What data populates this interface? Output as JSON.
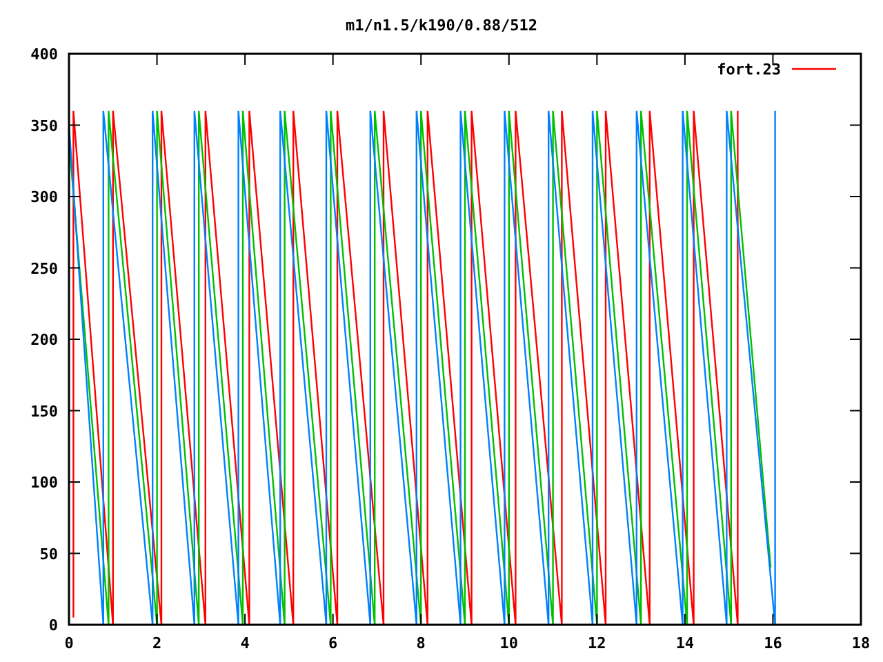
{
  "plot": {
    "chart_data": {
      "type": "line",
      "title": "m1/n1.5/k190/0.88/512",
      "xlim": [
        0,
        18
      ],
      "ylim": [
        0,
        400
      ],
      "xticks": [
        0,
        2,
        4,
        6,
        8,
        10,
        12,
        14,
        16,
        18
      ],
      "yticks": [
        0,
        50,
        100,
        150,
        200,
        250,
        300,
        350,
        400
      ],
      "series": [
        {
          "name": "fort.23",
          "color": "#ff0000",
          "x": [
            0.1,
            0.1,
            0.1,
            1.0,
            1.0,
            2.1,
            2.1,
            3.1,
            3.1,
            4.1,
            4.1,
            5.1,
            5.1,
            6.1,
            6.1,
            7.15,
            7.15,
            8.15,
            8.15,
            9.15,
            9.15,
            10.15,
            10.15,
            11.2,
            11.2,
            12.2,
            12.2,
            13.2,
            13.2,
            14.2,
            14.2,
            15.2,
            15.2
          ],
          "values": [
            5,
            360,
            360,
            0,
            360,
            0,
            360,
            0,
            360,
            0,
            360,
            0,
            360,
            0,
            360,
            0,
            360,
            0,
            360,
            0,
            360,
            0,
            360,
            0,
            360,
            0,
            360,
            0,
            360,
            0,
            360,
            0,
            360
          ]
        },
        {
          "color": "#00c000",
          "x": [
            0,
            0.9,
            0.9,
            2.0,
            2.0,
            2.95,
            2.95,
            3.95,
            3.95,
            4.9,
            4.9,
            5.95,
            5.95,
            6.95,
            6.95,
            8.0,
            8.0,
            9.0,
            9.0,
            10.0,
            10.0,
            11.0,
            11.0,
            12.0,
            12.0,
            13.0,
            13.0,
            14.05,
            14.05,
            15.05,
            15.05,
            15.95
          ],
          "values": [
            340,
            0,
            360,
            0,
            360,
            0,
            360,
            0,
            360,
            0,
            360,
            0,
            360,
            0,
            360,
            0,
            360,
            0,
            360,
            0,
            360,
            0,
            360,
            0,
            360,
            0,
            360,
            0,
            360,
            0,
            360,
            40
          ]
        },
        {
          "color": "#0080ff",
          "x": [
            0,
            0.78,
            0.78,
            1.9,
            1.9,
            2.85,
            2.85,
            3.85,
            3.85,
            4.8,
            4.8,
            5.85,
            5.85,
            6.85,
            6.85,
            7.9,
            7.9,
            8.9,
            8.9,
            9.9,
            9.9,
            10.9,
            10.9,
            11.9,
            11.9,
            12.9,
            12.9,
            13.95,
            13.95,
            14.95,
            14.95,
            16.05,
            16.05
          ],
          "values": [
            350,
            0,
            360,
            0,
            360,
            0,
            360,
            0,
            360,
            0,
            360,
            0,
            360,
            0,
            360,
            0,
            360,
            0,
            360,
            0,
            360,
            0,
            360,
            0,
            360,
            0,
            360,
            0,
            360,
            0,
            360,
            0,
            360
          ]
        }
      ]
    }
  }
}
